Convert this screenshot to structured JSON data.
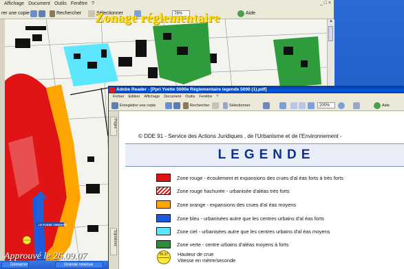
{
  "background_window": {
    "menu": [
      "Affichage",
      "Document",
      "Outils",
      "Fenêtre",
      "?"
    ],
    "window_buttons": "_ □ ×",
    "toolbar": {
      "save_copy": "rer une copie",
      "search": "Rechercher",
      "select": "Sélectionner",
      "zoom": "78%",
      "help": "Aide"
    },
    "overlay_title": "Zonage réglementaire",
    "map_label": "LE FOSSE / BRIGHTE",
    "approval_text": "Approuvé le 26.09.07"
  },
  "taskbar": {
    "item": "Démarrer",
    "item2": "Grande retenue"
  },
  "foreground_window": {
    "title": "Adobe Reader - [Ppri Yvette 5000e Réglementaire legende 5000 (1).pdf]",
    "menu": [
      "Fichier",
      "Edition",
      "Affichage",
      "Document",
      "Outils",
      "Fenêtre",
      "?"
    ],
    "toolbar": {
      "save_copy": "Enregistrer une copie",
      "search": "Rechercher",
      "select": "Sélectionner",
      "zoom": "200%",
      "help": "Aide"
    },
    "side_tabs": [
      "Pages",
      "Signatures"
    ],
    "document": {
      "copyright": "© DDE 91 - Service des Actions Juridiques , de l'Urbanisme et de l'Environnement -",
      "legend_title": "LEGENDE",
      "items": [
        {
          "color": "#e01414",
          "pattern": "solid",
          "label": "Zone rouge - écoulement et expansions des crues d'al  éas forts à très forts"
        },
        {
          "color": "#e01414",
          "pattern": "hatch",
          "label": "Zone rouge hachurée - urbanisée d'aléas très forts"
        },
        {
          "color": "#ffa500",
          "pattern": "solid",
          "label": "Zone orange - expansions des crues d'al  éas moyens"
        },
        {
          "color": "#1e5bdc",
          "pattern": "solid",
          "label": "Zone bleu - urbanisées autre que les centres urbains d'al   éas forts"
        },
        {
          "color": "#5ce6ff",
          "pattern": "solid",
          "label": "Zone ciel - urbanisées autre que les centres urbains d'al   éas moyens"
        },
        {
          "color": "#2e8b3c",
          "pattern": "solid",
          "label": "Zone verte - centre urbains d'aléas moyens à forts"
        }
      ],
      "flood_marker": {
        "icon_label": "55.37",
        "line1": "Hauteur de crue",
        "line2": "Vitesse en mètre/seconde"
      }
    }
  }
}
